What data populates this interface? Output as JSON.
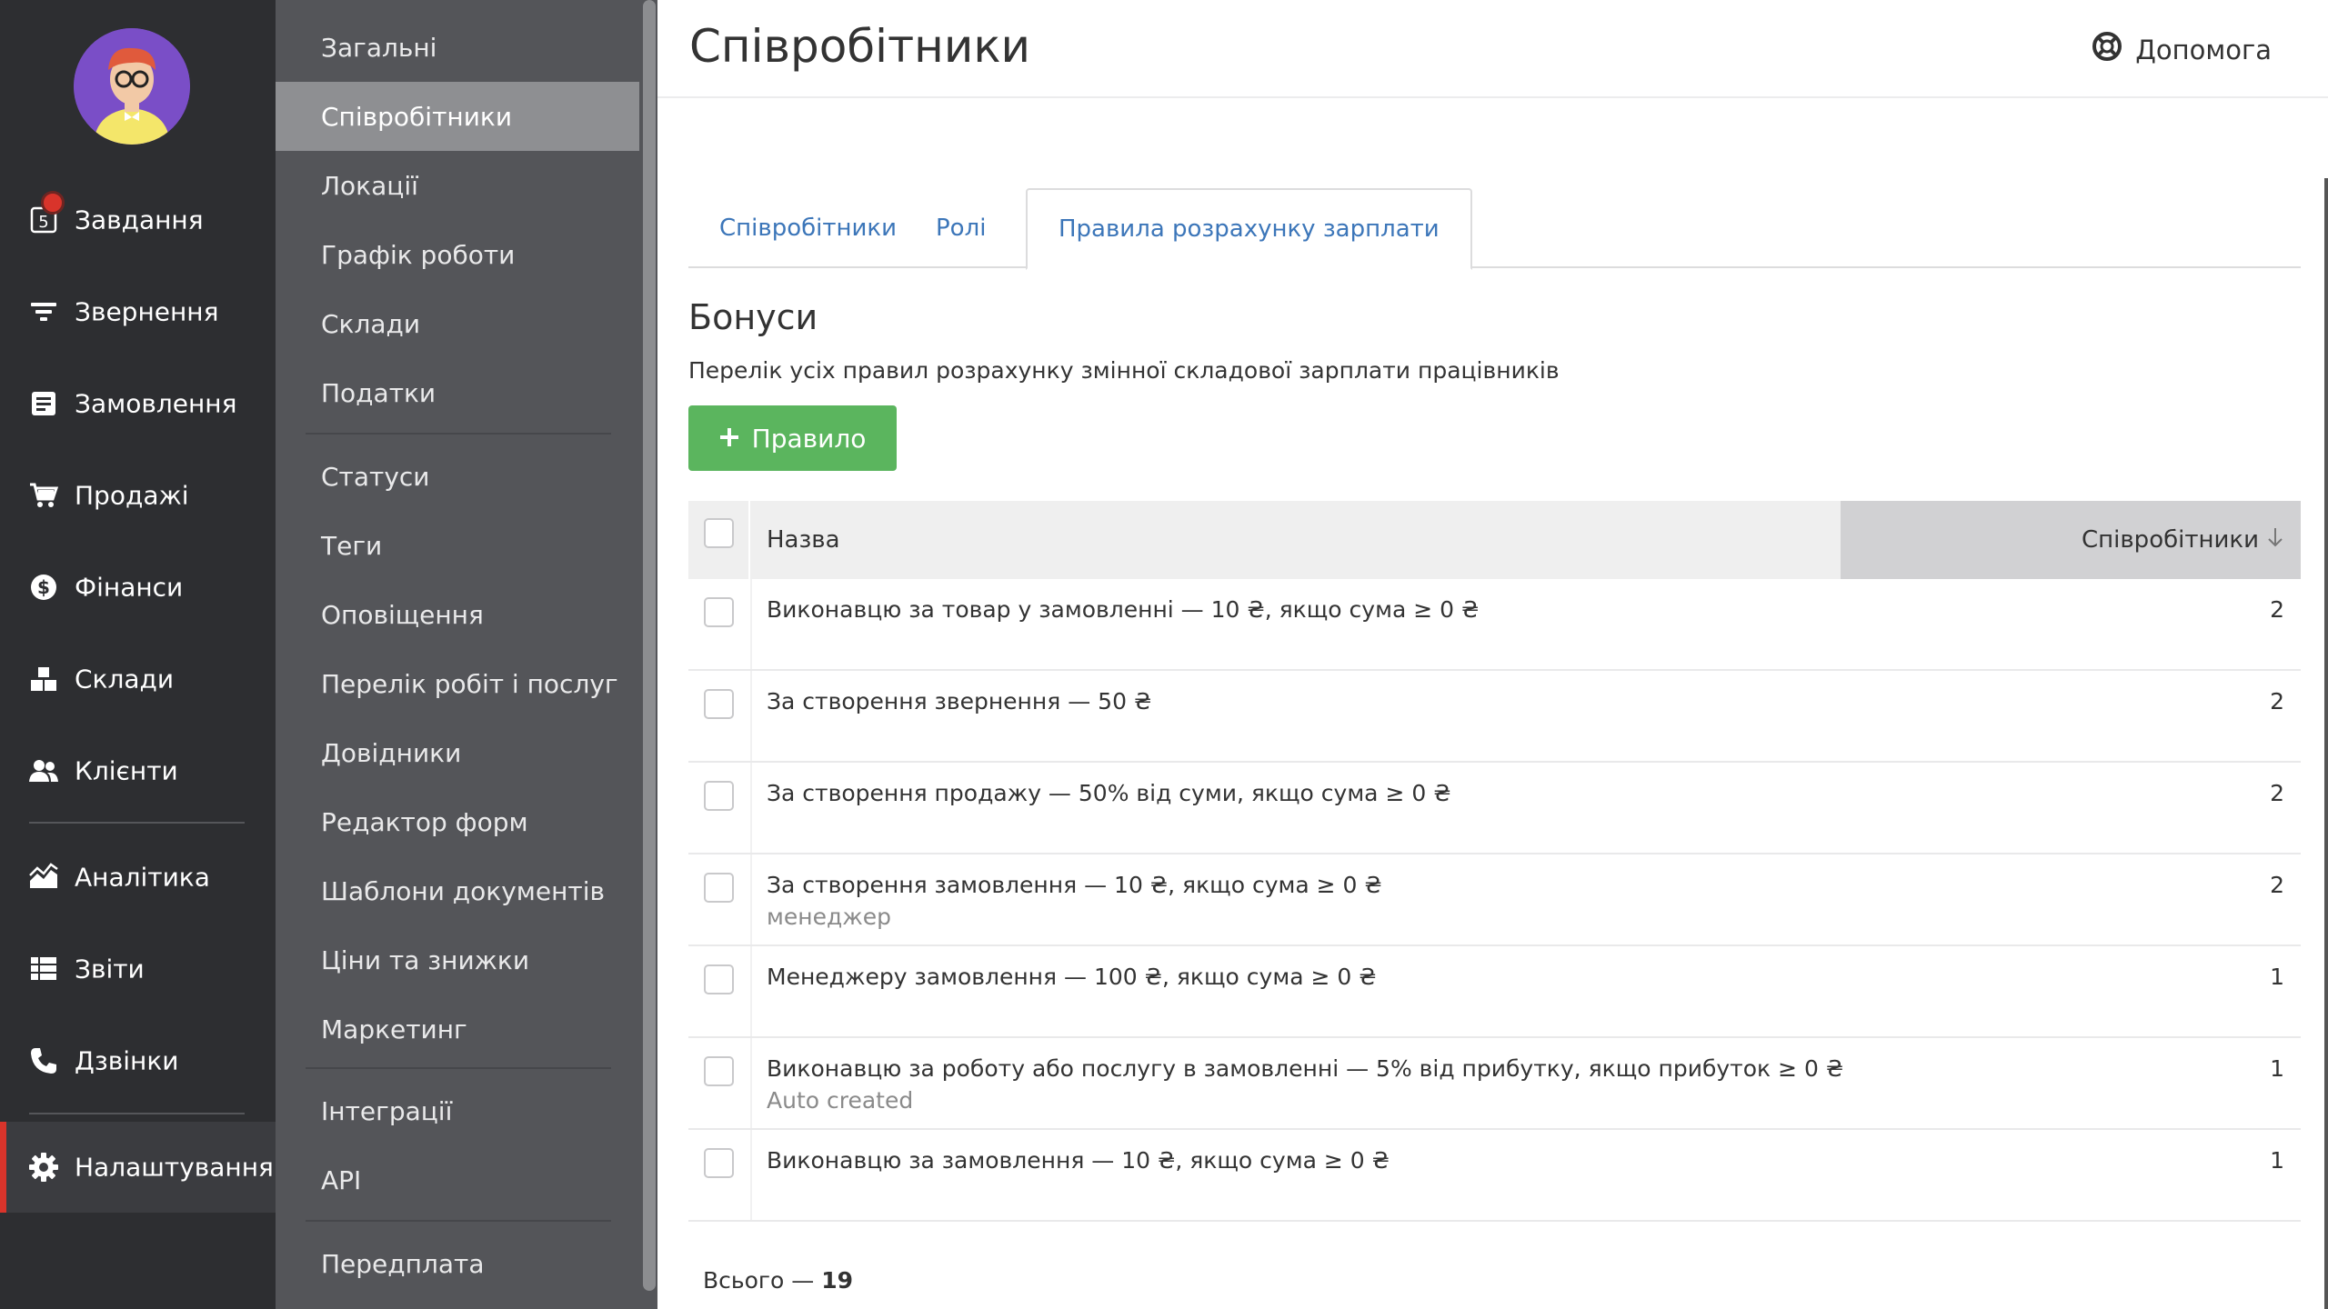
{
  "nav": {
    "items": [
      {
        "label": "Завдання",
        "icon": "tasks-icon",
        "badge": "5"
      },
      {
        "label": "Звернення",
        "icon": "filter-icon"
      },
      {
        "label": "Замовлення",
        "icon": "orders-icon"
      },
      {
        "label": "Продажі",
        "icon": "cart-icon"
      },
      {
        "label": "Фінанси",
        "icon": "dollar-icon"
      },
      {
        "label": "Склади",
        "icon": "boxes-icon"
      },
      {
        "label": "Клієнти",
        "icon": "users-icon"
      },
      {
        "label": "Аналітика",
        "icon": "chart-icon"
      },
      {
        "label": "Звіти",
        "icon": "list-icon"
      },
      {
        "label": "Дзвінки",
        "icon": "phone-icon"
      },
      {
        "label": "Налаштування",
        "icon": "gear-icon",
        "active": true
      }
    ],
    "accent_color": "#d9342b"
  },
  "subnav": {
    "items": [
      {
        "label": "Загальні"
      },
      {
        "label": "Співробітники",
        "active": true
      },
      {
        "label": "Локації"
      },
      {
        "label": "Графік роботи"
      },
      {
        "label": "Склади"
      },
      {
        "label": "Податки"
      },
      {
        "label": "Статуси"
      },
      {
        "label": "Теги"
      },
      {
        "label": "Оповіщення"
      },
      {
        "label": "Перелік робіт і послуг"
      },
      {
        "label": "Довідники"
      },
      {
        "label": "Редактор форм"
      },
      {
        "label": "Шаблони документів"
      },
      {
        "label": "Ціни та знижки"
      },
      {
        "label": "Маркетинг"
      },
      {
        "label": "Інтеграції"
      },
      {
        "label": "API"
      },
      {
        "label": "Передплата"
      }
    ]
  },
  "header": {
    "title": "Співробітники",
    "help_label": "Допомога"
  },
  "tabs": [
    {
      "label": "Співробітники"
    },
    {
      "label": "Ролі"
    },
    {
      "label": "Правила розрахунку зарплати",
      "active": true
    }
  ],
  "section": {
    "title": "Бонуси",
    "description": "Перелік усіх правил розрахунку змінної складової зарплати працівників",
    "add_button_label": "Правило"
  },
  "table": {
    "columns": {
      "name": "Назва",
      "employees": "Співробітники"
    },
    "rows": [
      {
        "name": "Виконавцю за товар у замовленні — 10 ₴, якщо сума ≥ 0 ₴",
        "sub": "",
        "count": "2"
      },
      {
        "name": "За створення звернення — 50 ₴",
        "sub": "",
        "count": "2"
      },
      {
        "name": "За створення продажу — 50% від суми, якщо сума ≥ 0 ₴",
        "sub": "",
        "count": "2"
      },
      {
        "name": "За створення замовлення — 10 ₴, якщо сума ≥ 0 ₴",
        "sub": "менеджер",
        "count": "2"
      },
      {
        "name": "Менеджеру замовлення — 100 ₴, якщо сума ≥ 0 ₴",
        "sub": "",
        "count": "1"
      },
      {
        "name": "Виконавцю за роботу або послугу в замовленні — 5% від прибутку, якщо прибуток ≥ 0 ₴",
        "sub": "Auto created",
        "count": "1"
      },
      {
        "name": "Виконавцю за замовлення — 10 ₴, якщо сума ≥ 0 ₴",
        "sub": "",
        "count": "1"
      }
    ]
  },
  "footer": {
    "total_label": "Всього —",
    "total_value": "19"
  }
}
